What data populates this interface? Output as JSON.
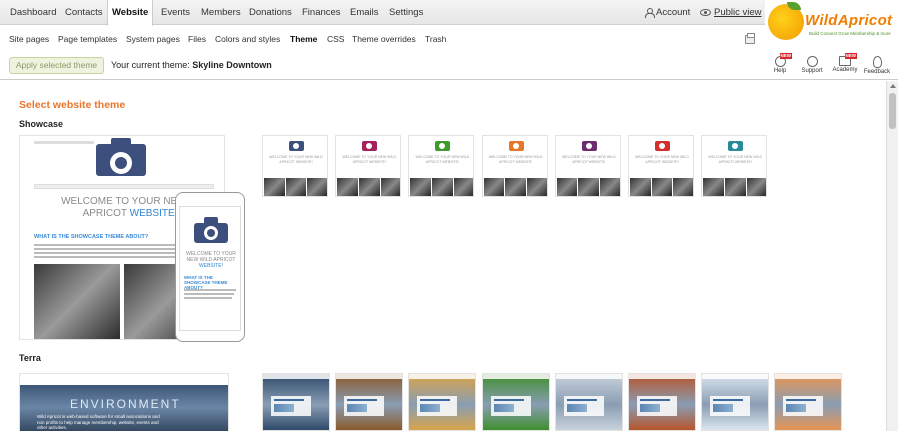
{
  "topnav": {
    "items": [
      "Dashboard",
      "Contacts",
      "Website",
      "Events",
      "Members",
      "Donations",
      "Finances",
      "Emails",
      "Settings"
    ],
    "active": "Website",
    "account": "Account",
    "public_view": "Public view"
  },
  "subnav": {
    "items": [
      "Site pages",
      "Page templates",
      "System pages",
      "Files",
      "Colors and styles",
      "Theme",
      "CSS",
      "Theme overrides",
      "Trash"
    ],
    "active": "Theme"
  },
  "logo": {
    "name": "WildApricot",
    "tagline": "Build Connect Grow   Membership & more"
  },
  "actionbar": {
    "apply_label": "Apply selected theme",
    "current_prefix": "Your current theme:",
    "current_theme": "Skyline Downtown",
    "tools": [
      {
        "label": "Help",
        "icon": "help-icon",
        "badge": "NEW"
      },
      {
        "label": "Support",
        "icon": "globe-icon",
        "badge": ""
      },
      {
        "label": "Academy",
        "icon": "book-icon",
        "badge": "NEW"
      },
      {
        "label": "Feedback",
        "icon": "bulb-icon",
        "badge": ""
      }
    ]
  },
  "content": {
    "page_title": "Select website theme",
    "sections": [
      {
        "name": "Showcase",
        "preview": {
          "welcome_line1": "WELCOME TO YOUR NEW W",
          "welcome_line2": "APRICOT",
          "welcome_highlight": "WEBSITE!",
          "about_heading": "WHAT IS THE SHOWCASE THEME ABOUT?",
          "phone_welcome_1": "WELCOME TO YOUR",
          "phone_welcome_2": "NEW WILD APRICOT",
          "phone_welcome_3": "WEBSITE!",
          "phone_heading": "WHAT IS THE SHOWCASE THEME ABOUT?"
        },
        "variant_colors": [
          "#3d4f7c",
          "#a2235c",
          "#3e9a2c",
          "#e8762a",
          "#6c2c6e",
          "#d2312e",
          "#2a8a99"
        ],
        "thumb_welcome": "WELCOME TO YOUR NEW WILD APRICOT WEBSITE!"
      },
      {
        "name": "Terra",
        "preview": {
          "hero_title": "ENVIRONMENT",
          "hero_sub": "Wild Apricot is web-based software for small associations and non profits to help manage membership, website, events and other activities."
        },
        "variant_colors": [
          "#2d4a6b",
          "#8a5a2a",
          "#d8a449",
          "#3f8f2e",
          "#c9d2db",
          "#b7542a",
          "#dbe6ef",
          "#e89552"
        ]
      }
    ]
  }
}
